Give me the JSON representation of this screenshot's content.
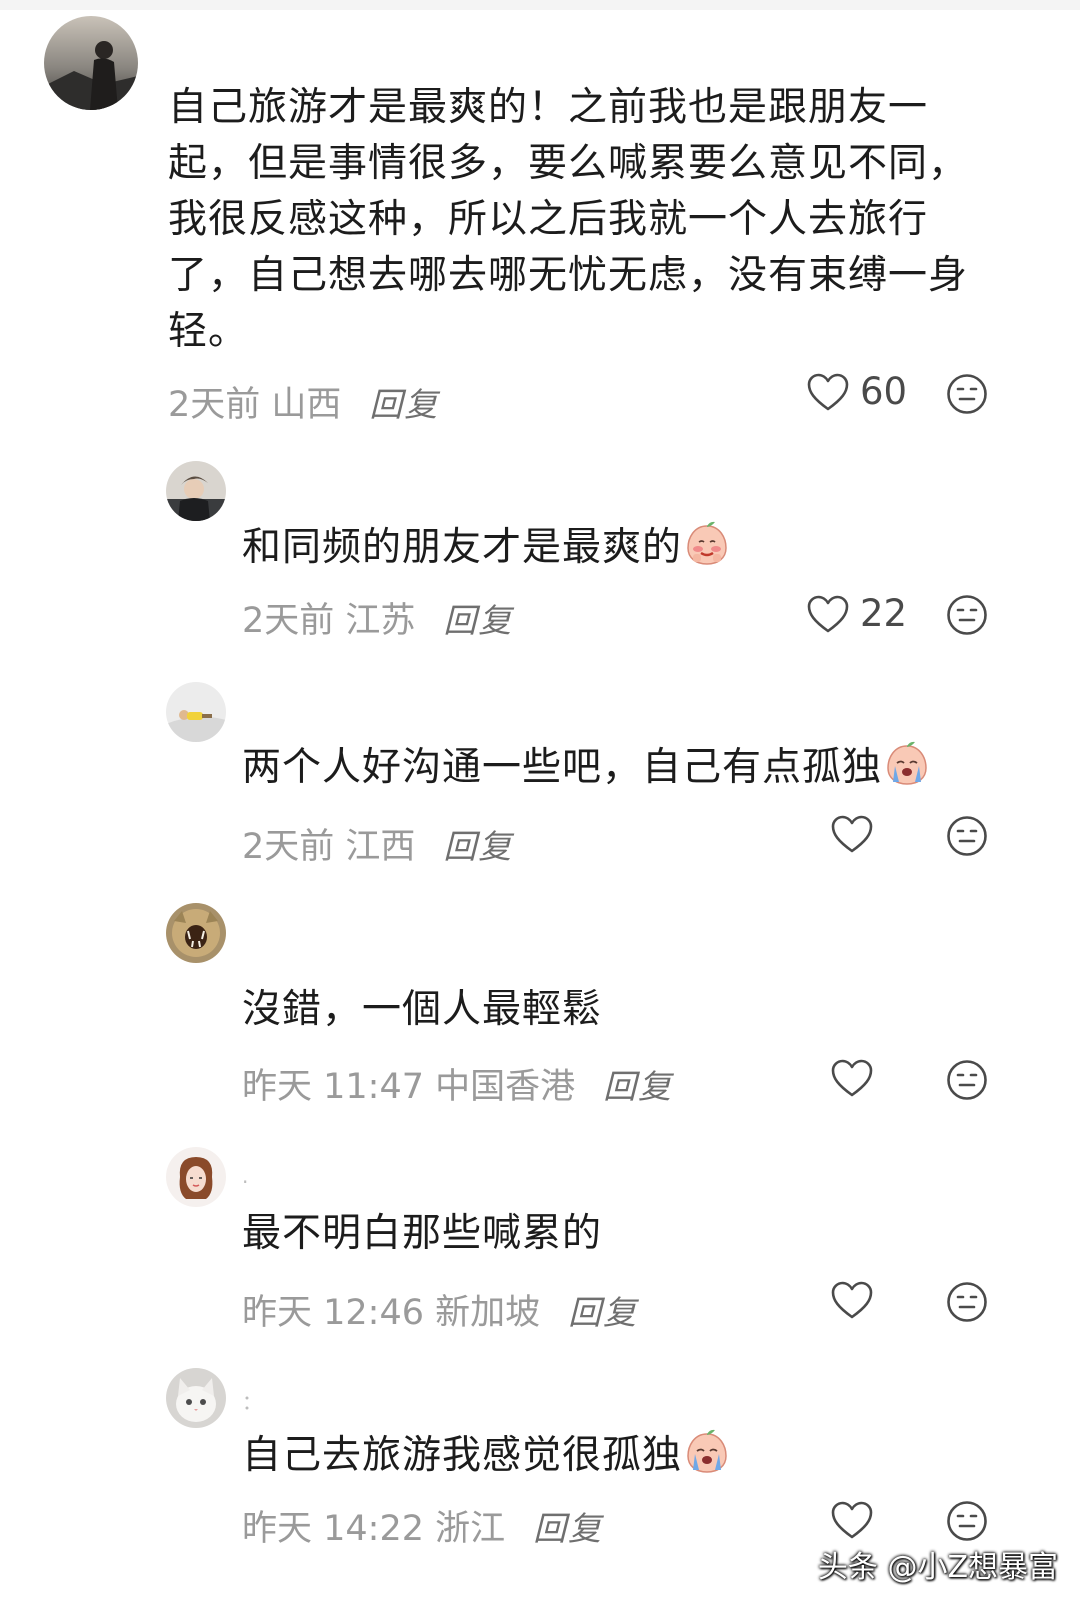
{
  "comments": [
    {
      "text": "自己旅游才是最爽的！之前我也是跟朋友一起，但是事情很多，要么喊累要么意见不同，我很反感这种，所以之后我就一个人去旅行了，自己想去哪去哪无忧无虑，没有束缚一身轻。",
      "meta": "2天前 山西",
      "reply": "回复",
      "likes": "60"
    },
    {
      "text": "和同频的朋友才是最爽的",
      "meta": "2天前 江苏",
      "reply": "回复",
      "likes": "22",
      "emoji": "blushing-peach-emoji"
    },
    {
      "text": "两个人好沟通一些吧，自己有点孤独",
      "meta": "2天前 江西",
      "reply": "回复",
      "likes": "",
      "emoji": "crying-peach-emoji"
    },
    {
      "text": "沒錯，一個人最輕鬆",
      "meta": "昨天 11:47 中国香港",
      "reply": "回复",
      "likes": ""
    },
    {
      "nickname": "·",
      "text": "最不明白那些喊累的",
      "meta": "昨天 12:46 新加坡",
      "reply": "回复",
      "likes": ""
    },
    {
      "nickname": "：",
      "text": "自己去旅游我感觉很孤独",
      "meta": "昨天 14:22 浙江",
      "reply": "回复",
      "likes": "",
      "emoji": "crying-peach-emoji"
    }
  ],
  "icons": {
    "like": "heart-outline-icon",
    "dislike": "neutral-face-icon"
  },
  "watermark": "头条 @小Z想暴富"
}
